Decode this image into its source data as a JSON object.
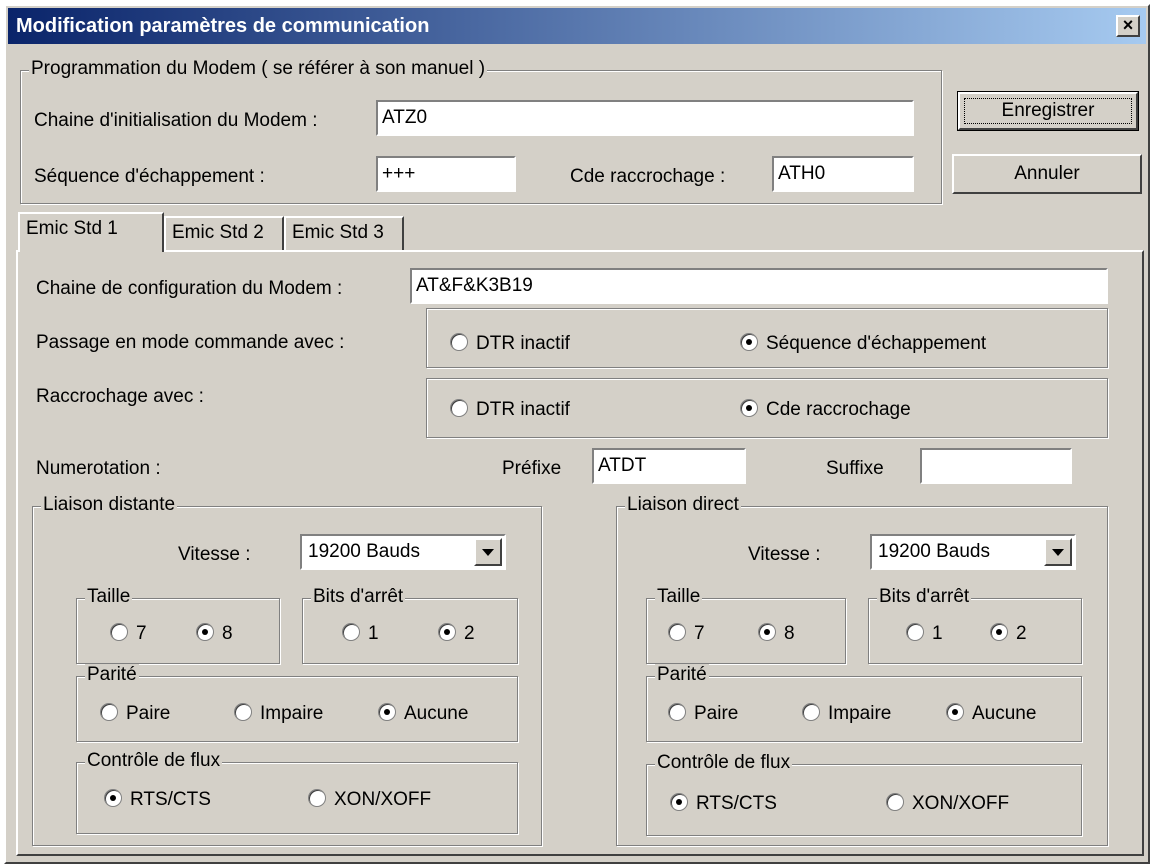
{
  "window": {
    "title": "Modification paramètres de communication",
    "close_label": "×"
  },
  "modem": {
    "group_title": "Programmation du Modem ( se référer à son manuel )",
    "init_label": "Chaine d'initialisation du Modem :",
    "init_value": "ATZ0",
    "escape_label": "Séquence  d'échappement :",
    "escape_value": "+++",
    "hangup_label": "Cde raccrochage :",
    "hangup_value": "ATH0"
  },
  "buttons": {
    "save": "Enregistrer",
    "cancel": "Annuler"
  },
  "tabs": [
    {
      "label": "Emic Std 1"
    },
    {
      "label": "Emic Std 2"
    },
    {
      "label": "Emic Std 3"
    }
  ],
  "config": {
    "config_label": "Chaine de configuration du Modem :",
    "config_value": "AT&F&K3B19",
    "command_mode_label": "Passage en mode commande avec :",
    "command_mode_options": [
      "DTR inactif",
      "Séquence d'échappement"
    ],
    "hangup_with_label": "Raccrochage avec :",
    "hangup_with_options": [
      "DTR inactif",
      "Cde raccrochage"
    ],
    "dial_label": "Numerotation :",
    "prefix_label": "Préfixe",
    "prefix_value": "ATDT",
    "suffix_label": "Suffixe",
    "suffix_value": ""
  },
  "links": [
    {
      "title": "Liaison distante",
      "speed_label": "Vitesse :",
      "speed_value": "19200 Bauds",
      "size_title": "Taille",
      "size_options": [
        "7",
        "8"
      ],
      "stop_title": "Bits d'arrêt",
      "stop_options": [
        "1",
        "2"
      ],
      "parity_title": "Parité",
      "parity_options": [
        "Paire",
        "Impaire",
        "Aucune"
      ],
      "flow_title": "Contrôle de flux",
      "flow_options": [
        "RTS/CTS",
        "XON/XOFF"
      ]
    },
    {
      "title": "Liaison direct",
      "speed_label": "Vitesse :",
      "speed_value": "19200 Bauds",
      "size_title": "Taille",
      "size_options": [
        "7",
        "8"
      ],
      "stop_title": "Bits d'arrêt",
      "stop_options": [
        "1",
        "2"
      ],
      "parity_title": "Parité",
      "parity_options": [
        "Paire",
        "Impaire",
        "Aucune"
      ],
      "flow_title": "Contrôle de flux",
      "flow_options": [
        "RTS/CTS",
        "XON/XOFF"
      ]
    }
  ]
}
